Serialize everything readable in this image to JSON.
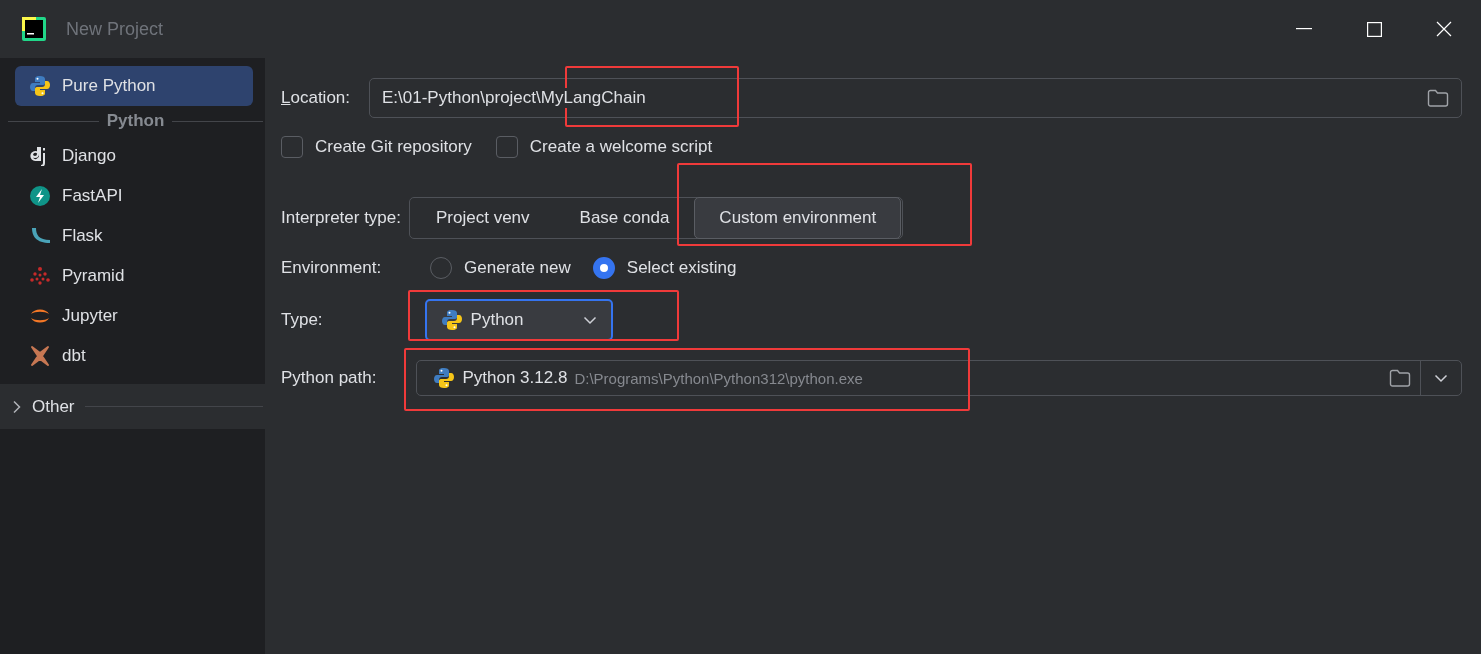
{
  "window": {
    "title": "New Project"
  },
  "sidebar": {
    "top_items": [
      {
        "label": "Pure Python",
        "selected": true
      }
    ],
    "group_header": "Python",
    "items": [
      {
        "label": "Django",
        "selected": false
      },
      {
        "label": "FastAPI",
        "selected": false
      },
      {
        "label": "Flask",
        "selected": false
      },
      {
        "label": "Pyramid",
        "selected": false
      },
      {
        "label": "Jupyter",
        "selected": false
      },
      {
        "label": "dbt",
        "selected": false
      }
    ],
    "other": {
      "label": "Other",
      "expanded": false
    }
  },
  "location": {
    "label": "Location:",
    "value": "E:\\01-Python\\project\\MyLangChain",
    "highlighted": true
  },
  "checkboxes": [
    {
      "label": "Create Git repository",
      "checked": false
    },
    {
      "label": "Create a welcome script",
      "checked": false
    }
  ],
  "interpreter_type": {
    "label": "Interpreter type:",
    "options": [
      {
        "label": "Project venv",
        "selected": false,
        "highlighted": false
      },
      {
        "label": "Base conda",
        "selected": false,
        "highlighted": false
      },
      {
        "label": "Custom environment",
        "selected": true,
        "highlighted": true
      }
    ]
  },
  "environment": {
    "label": "Environment:",
    "options": [
      {
        "label": "Generate new",
        "selected": false
      },
      {
        "label": "Select existing",
        "selected": true
      }
    ]
  },
  "type": {
    "label": "Type:",
    "value": "Python",
    "highlighted": true
  },
  "python_path": {
    "label": "Python path:",
    "version": "Python 3.12.8",
    "path": "D:\\Programs\\Python\\Python312\\python.exe",
    "highlighted": true
  }
}
